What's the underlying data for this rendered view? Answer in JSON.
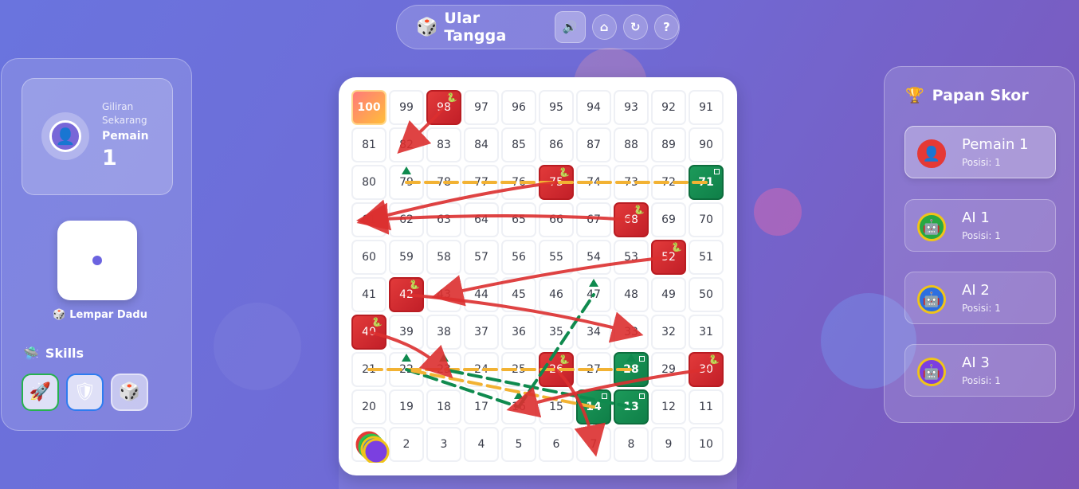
{
  "header": {
    "title": "Ular Tangga",
    "icons": [
      "dice-icon",
      "volume-icon",
      "home-icon",
      "restart-icon",
      "help-icon"
    ]
  },
  "turn": {
    "label": "Giliran Sekarang",
    "player_name": "Pemain",
    "player_number": "1"
  },
  "dice": {
    "value": 1,
    "roll_label": "Lempar Dadu"
  },
  "skills": {
    "title": "Skills",
    "items": [
      "rocket-icon",
      "shield-icon",
      "dice-icon"
    ]
  },
  "board": {
    "rows": [
      [
        "100",
        "99",
        "98",
        "97",
        "96",
        "95",
        "94",
        "93",
        "92",
        "91"
      ],
      [
        "81",
        "82",
        "83",
        "84",
        "85",
        "86",
        "87",
        "88",
        "89",
        "90"
      ],
      [
        "80",
        "79",
        "78",
        "77",
        "76",
        "75",
        "74",
        "73",
        "72",
        "71"
      ],
      [
        "61",
        "62",
        "63",
        "64",
        "65",
        "66",
        "67",
        "68",
        "69",
        "70"
      ],
      [
        "60",
        "59",
        "58",
        "57",
        "56",
        "55",
        "54",
        "53",
        "52",
        "51"
      ],
      [
        "41",
        "42",
        "43",
        "44",
        "45",
        "46",
        "47",
        "48",
        "49",
        "50"
      ],
      [
        "40",
        "39",
        "38",
        "37",
        "36",
        "35",
        "34",
        "33",
        "32",
        "31"
      ],
      [
        "21",
        "22",
        "23",
        "24",
        "25",
        "26",
        "27",
        "28",
        "29",
        "30"
      ],
      [
        "20",
        "19",
        "18",
        "17",
        "16",
        "15",
        "14",
        "13",
        "12",
        "11"
      ],
      [
        "1",
        "2",
        "3",
        "4",
        "5",
        "6",
        "7",
        "8",
        "9",
        "10"
      ]
    ],
    "snake_heads": [
      "98",
      "75",
      "68",
      "52",
      "42",
      "40",
      "26",
      "30"
    ],
    "ladder_tops": [
      "71",
      "28",
      "14",
      "13"
    ],
    "snakes": [
      [
        98,
        82
      ],
      [
        75,
        61
      ],
      [
        68,
        61
      ],
      [
        52,
        43
      ],
      [
        42,
        33
      ],
      [
        40,
        23
      ],
      [
        26,
        7
      ],
      [
        30,
        16
      ]
    ],
    "ladders": [
      [
        21,
        28
      ],
      [
        22,
        16
      ],
      [
        14,
        22
      ],
      [
        13,
        23
      ],
      [
        71,
        79
      ],
      [
        16,
        47
      ]
    ],
    "colors": {
      "snake": "#dc2f2f",
      "ladder": "#0f8a4e",
      "ladder_alt": "#f2b233"
    }
  },
  "scoreboard": {
    "title": "Papan Skor",
    "players": [
      {
        "name": "Pemain 1",
        "position": "Posisi: 1",
        "icon": "person-icon",
        "ring": "#e53935",
        "bg": "#e53935"
      },
      {
        "name": "AI 1",
        "position": "Posisi: 1",
        "icon": "robot-icon",
        "ring": "#2fbf4f",
        "bg": "#27a843"
      },
      {
        "name": "AI 2",
        "position": "Posisi: 1",
        "icon": "robot-icon",
        "ring": "#f0c419",
        "bg": "#2d6fe0"
      },
      {
        "name": "AI 3",
        "position": "Posisi: 1",
        "icon": "robot-icon",
        "ring": "#f0c419",
        "bg": "#7b3fe0"
      }
    ]
  }
}
